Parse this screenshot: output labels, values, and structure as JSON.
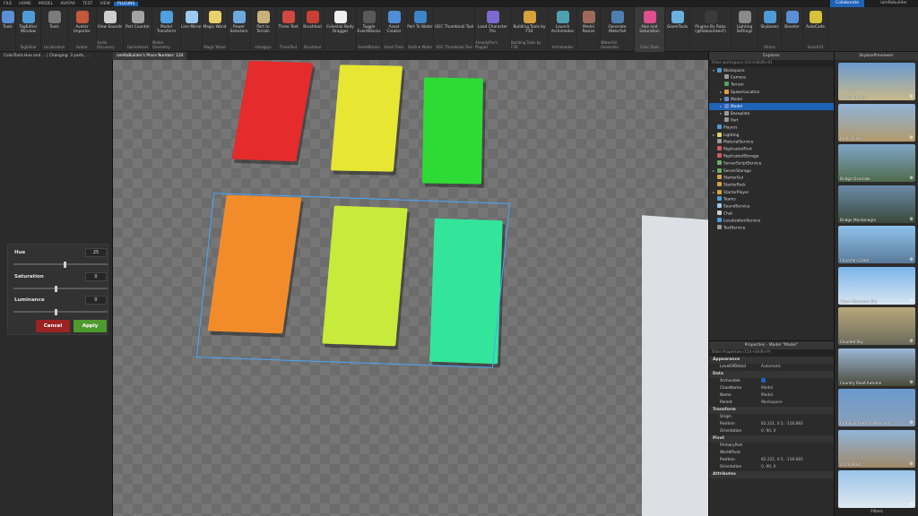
{
  "menubar": {
    "items": [
      "FILE",
      "HOME",
      "MODEL",
      "AVATAR",
      "TEST",
      "VIEW",
      "PLUGINS"
    ],
    "active": "PLUGINS",
    "collaborate": "Collaborate",
    "user": "iamRobuilder"
  },
  "ribbon": [
    {
      "label": "Tools",
      "group": "",
      "color": "#5b8fd6"
    },
    {
      "label": "TagEditor Window",
      "group": "TagEditor",
      "color": "#4f9bd6"
    },
    {
      "label": "Tools",
      "group": "Localization",
      "color": "#7c7c7c"
    },
    {
      "label": "Avatar Importer",
      "group": "Avatar",
      "color": "#c7573c"
    },
    {
      "label": "View Sounds",
      "group": "Audio Discovery",
      "color": "#cfcfcf"
    },
    {
      "label": "Part Counter",
      "group": "GameAssist",
      "color": "#a3a3a3"
    },
    {
      "label": "Model Transform",
      "group": "Model Geometry",
      "color": "#4fa0e0"
    },
    {
      "label": "Line Mirror",
      "group": "",
      "color": "#9ccaf0"
    },
    {
      "label": "Magic Wand",
      "group": "Magic Wand",
      "color": "#e8d16a"
    },
    {
      "label": "Power Selectors",
      "group": "",
      "color": "#6ea8e0"
    },
    {
      "label": "Part to Terrain",
      "group": "vhzagzys",
      "color": "#c9b27a"
    },
    {
      "label": "Three Text",
      "group": "ThreeText",
      "color": "#d0483f"
    },
    {
      "label": "Brushtool",
      "group": "Brushtool",
      "color": "#c84032"
    },
    {
      "label": "Celestial Body Dragger",
      "group": "",
      "color": "#f0f0f0"
    },
    {
      "label": "Toggle EventBlocks",
      "group": "EventBlocks",
      "color": "#5a5a5a"
    },
    {
      "label": "Asset Creator",
      "group": "Asset Tools",
      "color": "#4f8fd6"
    },
    {
      "label": "Part To Water",
      "group": "Outline Water",
      "color": "#3c85c9"
    },
    {
      "label": "UGC Thumbnail Tool",
      "group": "UGC Thumbnail Tool",
      "color": "#2e2e2e"
    },
    {
      "label": "Load Character Pro",
      "group": "AlreadyPro's Plugins",
      "color": "#7c6ad0"
    },
    {
      "label": "Building Tools by F3X",
      "group": "Building Tools by F3X",
      "color": "#d6a23c"
    },
    {
      "label": "Launch Archimedes",
      "group": "Archimedes",
      "color": "#4fa0b0"
    },
    {
      "label": "Model Resize",
      "group": "",
      "color": "#a06a5a"
    },
    {
      "label": "Generate Waterfall",
      "group": "Waterfall Generator",
      "color": "#4f7fb0"
    },
    {
      "label": "Hue and Saturation",
      "group": "Color Tools",
      "color": "#e04f8f"
    },
    {
      "label": "GeomTools",
      "group": "",
      "color": "#6ab0e0"
    },
    {
      "label": "Plugins By Robo (@RoboonikesF)",
      "group": "",
      "color": "#3a3a3a"
    },
    {
      "label": "Lighting Settings",
      "group": "",
      "color": "#8a8a8a"
    },
    {
      "label": "Skyboxes",
      "group": "Atmos",
      "color": "#4f9bd6"
    },
    {
      "label": "Beveler",
      "group": "",
      "color": "#5a8fd6"
    },
    {
      "label": "AutoCode",
      "group": "Axiom53",
      "color": "#d6c23c"
    }
  ],
  "tabs": [
    "ColorTools Hue and ... | Changing: 3 parts, ...",
    "iamRoBuilder's Place Number: 124"
  ],
  "hsl": {
    "hue_label": "Hue",
    "hue_value": "25",
    "hue_level": 0.55,
    "sat_label": "Saturation",
    "sat_value": "0",
    "sat_level": 0.45,
    "lum_label": "Luminance",
    "lum_value": "0",
    "lum_level": 0.45,
    "cancel": "Cancel",
    "apply": "Apply"
  },
  "blocks": [
    {
      "color": "#e52b2b",
      "name": "red-block"
    },
    {
      "color": "#e7e632",
      "name": "yellow-block"
    },
    {
      "color": "#2edb35",
      "name": "green-block"
    },
    {
      "color": "#f28c2b",
      "name": "orange-block"
    },
    {
      "color": "#c8ea3b",
      "name": "lime-block"
    },
    {
      "color": "#33e59a",
      "name": "teal-block"
    }
  ],
  "explorer": {
    "title": "Explorer",
    "filter": "Filter workspace (Ctrl+Shift+X)",
    "items": [
      {
        "label": "Workspace",
        "arrow": "▾",
        "color": "#4f9bd6",
        "selected": false
      },
      {
        "label": "Camera",
        "arrow": "",
        "color": "#9a9a9a",
        "selected": false
      },
      {
        "label": "Terrain",
        "arrow": "",
        "color": "#5aa05a",
        "selected": false
      },
      {
        "label": "SpawnLocation",
        "arrow": "▸",
        "color": "#e0a040",
        "selected": false
      },
      {
        "label": "Model",
        "arrow": "▸",
        "color": "#6a8ad0",
        "selected": false
      },
      {
        "label": "Model",
        "arrow": "▸",
        "color": "#6a8ad0",
        "selected": true
      },
      {
        "label": "Baseplate",
        "arrow": "▸",
        "color": "#9a9a9a",
        "selected": false
      },
      {
        "label": "Part",
        "arrow": "",
        "color": "#9a9a9a",
        "selected": false
      },
      {
        "label": "Players",
        "arrow": "",
        "color": "#4f9bd6",
        "selected": false
      },
      {
        "label": "Lighting",
        "arrow": "▸",
        "color": "#e8d16a",
        "selected": false
      },
      {
        "label": "MaterialService",
        "arrow": "",
        "color": "#9a9a9a",
        "selected": false
      },
      {
        "label": "ReplicatedFirst",
        "arrow": "",
        "color": "#d05a5a",
        "selected": false
      },
      {
        "label": "ReplicatedStorage",
        "arrow": "",
        "color": "#d05a5a",
        "selected": false
      },
      {
        "label": "ServerScriptService",
        "arrow": "",
        "color": "#6ab06a",
        "selected": false
      },
      {
        "label": "ServerStorage",
        "arrow": "▸",
        "color": "#6ab06a",
        "selected": false
      },
      {
        "label": "StarterGui",
        "arrow": "",
        "color": "#d6a23c",
        "selected": false
      },
      {
        "label": "StarterPack",
        "arrow": "",
        "color": "#d6a23c",
        "selected": false
      },
      {
        "label": "StarterPlayer",
        "arrow": "▸",
        "color": "#d6a23c",
        "selected": false
      },
      {
        "label": "Teams",
        "arrow": "",
        "color": "#4f9bd6",
        "selected": false
      },
      {
        "label": "SoundService",
        "arrow": "",
        "color": "#9ccaf0",
        "selected": false
      },
      {
        "label": "Chat",
        "arrow": "",
        "color": "#cfcfcf",
        "selected": false
      },
      {
        "label": "LocalizationService",
        "arrow": "",
        "color": "#4f9bd6",
        "selected": false
      },
      {
        "label": "TestService",
        "arrow": "",
        "color": "#9a9a9a",
        "selected": false
      }
    ]
  },
  "properties": {
    "title": "Properties - Model \"Model\"",
    "filter": "Filter Properties (Ctrl+Shift+P)",
    "rows": [
      {
        "type": "section",
        "k": "Appearance"
      },
      {
        "type": "prop",
        "k": "LevelOfDetail",
        "v": "Automatic"
      },
      {
        "type": "section",
        "k": "Data"
      },
      {
        "type": "prop",
        "k": "Archivable",
        "v": "",
        "check": true
      },
      {
        "type": "prop",
        "k": "ClassName",
        "v": "Model"
      },
      {
        "type": "prop",
        "k": "Name",
        "v": "Model"
      },
      {
        "type": "prop",
        "k": "Parent",
        "v": "Workspace"
      },
      {
        "type": "section",
        "k": "Transform"
      },
      {
        "type": "prop",
        "k": "Origin",
        "v": ""
      },
      {
        "type": "prop",
        "k": "Position",
        "v": "82.221, 0.5, -118.683"
      },
      {
        "type": "prop",
        "k": "Orientation",
        "v": "0, 90, 0"
      },
      {
        "type": "section",
        "k": "Pivot"
      },
      {
        "type": "prop",
        "k": "PrimaryPart",
        "v": ""
      },
      {
        "type": "prop",
        "k": "WorldPivot",
        "v": ""
      },
      {
        "type": "prop",
        "k": "Position",
        "v": "82.221, 0.5, -118.683"
      },
      {
        "type": "prop",
        "k": "Orientation",
        "v": "0, 90, 0"
      },
      {
        "type": "section",
        "k": "Attributes"
      }
    ]
  },
  "skybox": {
    "title": "SkyboxPreviewer",
    "footer": "Filters",
    "items": [
      {
        "name": "Afternoon Sky",
        "top": "#6a9ad0",
        "bottom": "#c9b98a"
      },
      {
        "name": "Baltic Dune",
        "top": "#8fb4d8",
        "bottom": "#b39a6a"
      },
      {
        "name": "Bridge Overlake",
        "top": "#7fa6c8",
        "bottom": "#4f6a4a"
      },
      {
        "name": "Bridge Montenegro",
        "top": "#6a8aa8",
        "bottom": "#3a4a3a"
      },
      {
        "name": "Canarian Coast",
        "top": "#8fc2ea",
        "bottom": "#5a7a9a"
      },
      {
        "name": "Clear Afternoon Sky",
        "top": "#7ab4ea",
        "bottom": "#d8e6f2"
      },
      {
        "name": "Clouded Sky",
        "top": "#b8a87a",
        "bottom": "#6a6a5a"
      },
      {
        "name": "Country Road Autumn",
        "top": "#9ab8d6",
        "bottom": "#4a4a3a"
      },
      {
        "name": "Cumulus Fractus Afternoon",
        "top": "#6a9ad0",
        "bottom": "#8aa0b8"
      },
      {
        "name": "D109 Road",
        "top": "#8fb4d8",
        "bottom": "#a08a6a"
      },
      {
        "name": "",
        "top": "#9ac4ea",
        "bottom": "#dfe8f0"
      }
    ]
  }
}
